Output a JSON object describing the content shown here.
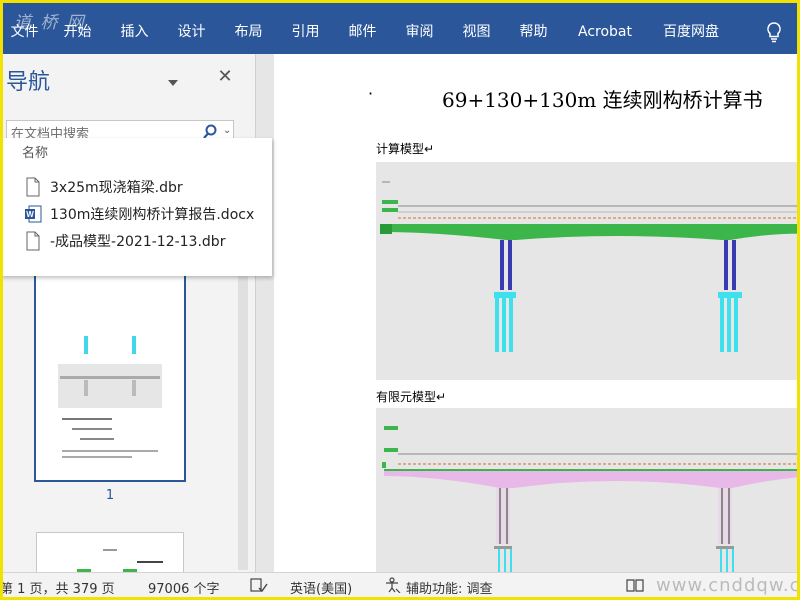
{
  "watermark": "道 桥 网",
  "ribbon": {
    "tabs": [
      "文件",
      "开始",
      "插入",
      "设计",
      "布局",
      "引用",
      "邮件",
      "审阅",
      "视图",
      "帮助",
      "Acrobat",
      "百度网盘"
    ],
    "tab_positions_note": ""
  },
  "nav": {
    "title": "导航",
    "search_placeholder": "在文档中搜索",
    "popup_header": "名称",
    "popup_items": [
      {
        "label": "3x25m现浇箱梁.dbr",
        "icon": "file-icon"
      },
      {
        "label": "130m连续刚构桥计算报告.docx",
        "icon": "word-icon"
      },
      {
        "label": "-成品模型-2021-12-13.dbr",
        "icon": "file-icon"
      }
    ],
    "page_number": "1"
  },
  "document": {
    "bullet": "·",
    "title": "69+130+130m 连续刚构桥计算书",
    "caption1": "计算模型↵",
    "caption2": "有限元模型↵"
  },
  "status": {
    "page_info": "第 1 页，共 379 页",
    "word_count": "97006 个字",
    "language": "英语(美国)",
    "accessibility": "辅助功能: 调查",
    "site_watermark": "www.cnddqw.com"
  },
  "colors": {
    "ribbon": "#2b579a",
    "frame": "#f2e200",
    "girder_green": "#3cb64a",
    "pier_blue": "#3a3ab0",
    "pile_cyan": "#3ee0ee"
  }
}
